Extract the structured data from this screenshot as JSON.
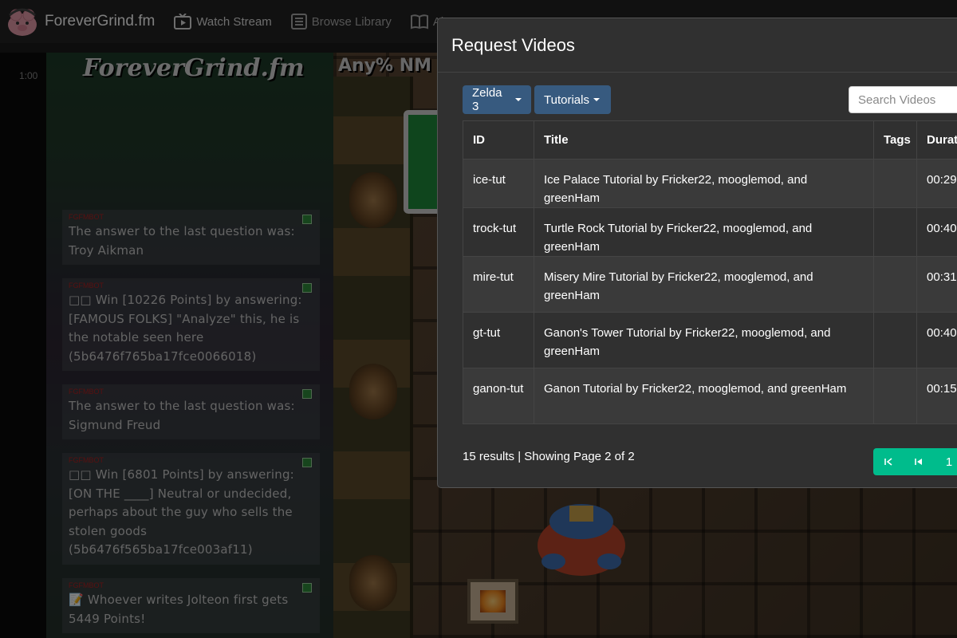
{
  "navbar": {
    "brand": "ForeverGrind.fm",
    "items": [
      {
        "label": "Watch Stream",
        "icon": "tv-icon"
      },
      {
        "label": "Browse Library",
        "icon": "library-icon"
      },
      {
        "label": "Abo",
        "icon": "book-icon"
      }
    ]
  },
  "stream": {
    "timer": "1:00",
    "chat_title": "ForeverGrind.fm",
    "game_title": "Any% NM",
    "chat": [
      {
        "user": "FGFMBOT",
        "text": "The answer to the last question was: Troy Aikman"
      },
      {
        "user": "FGFMBOT",
        "text": "□□ Win [10226 Points] by answering: [FAMOUS FOLKS] \"Analyze\" this, he is the notable seen here (5b6476f765ba17fce0066018)"
      },
      {
        "user": "FGFMBOT",
        "text": "The answer to the last question was: Sigmund Freud"
      },
      {
        "user": "FGFMBOT",
        "text": "□□ Win [6801 Points] by answering: [ON THE ____] Neutral or undecided, perhaps about the guy who sells the stolen goods (5b6476f565ba17fce003af11)"
      },
      {
        "user": "FGFMBOT",
        "text": "📝 Whoever writes Jolteon first gets 5449 Points!"
      }
    ]
  },
  "modal": {
    "title": "Request Videos",
    "game_filter": "Zelda 3",
    "category_filter": "Tutorials",
    "search_placeholder": "Search Videos",
    "columns": [
      "ID",
      "Title",
      "Tags",
      "Durat"
    ],
    "rows": [
      {
        "id": "ice-tut",
        "title": "Ice Palace Tutorial by Fricker22, mooglemod, and greenHam",
        "tags": "",
        "duration": "00:29"
      },
      {
        "id": "trock-tut",
        "title": "Turtle Rock Tutorial by Fricker22, mooglemod, and greenHam",
        "tags": "",
        "duration": "00:40"
      },
      {
        "id": "mire-tut",
        "title": "Misery Mire Tutorial by Fricker22, mooglemod, and greenHam",
        "tags": "",
        "duration": "00:31"
      },
      {
        "id": "gt-tut",
        "title": "Ganon's Tower Tutorial by Fricker22, mooglemod, and greenHam",
        "tags": "",
        "duration": "00:40"
      },
      {
        "id": "ganon-tut",
        "title": "Ganon Tutorial by Fricker22, mooglemod, and greenHam",
        "tags": "",
        "duration": "00:15"
      }
    ],
    "results_text": "15 results | Showing Page 2 of 2",
    "pager": {
      "first": "⇤",
      "prev": "⏮",
      "page": "1"
    }
  },
  "colors": {
    "primary": "#375a7f",
    "success": "#00bc8c",
    "modal_bg": "#303030"
  }
}
